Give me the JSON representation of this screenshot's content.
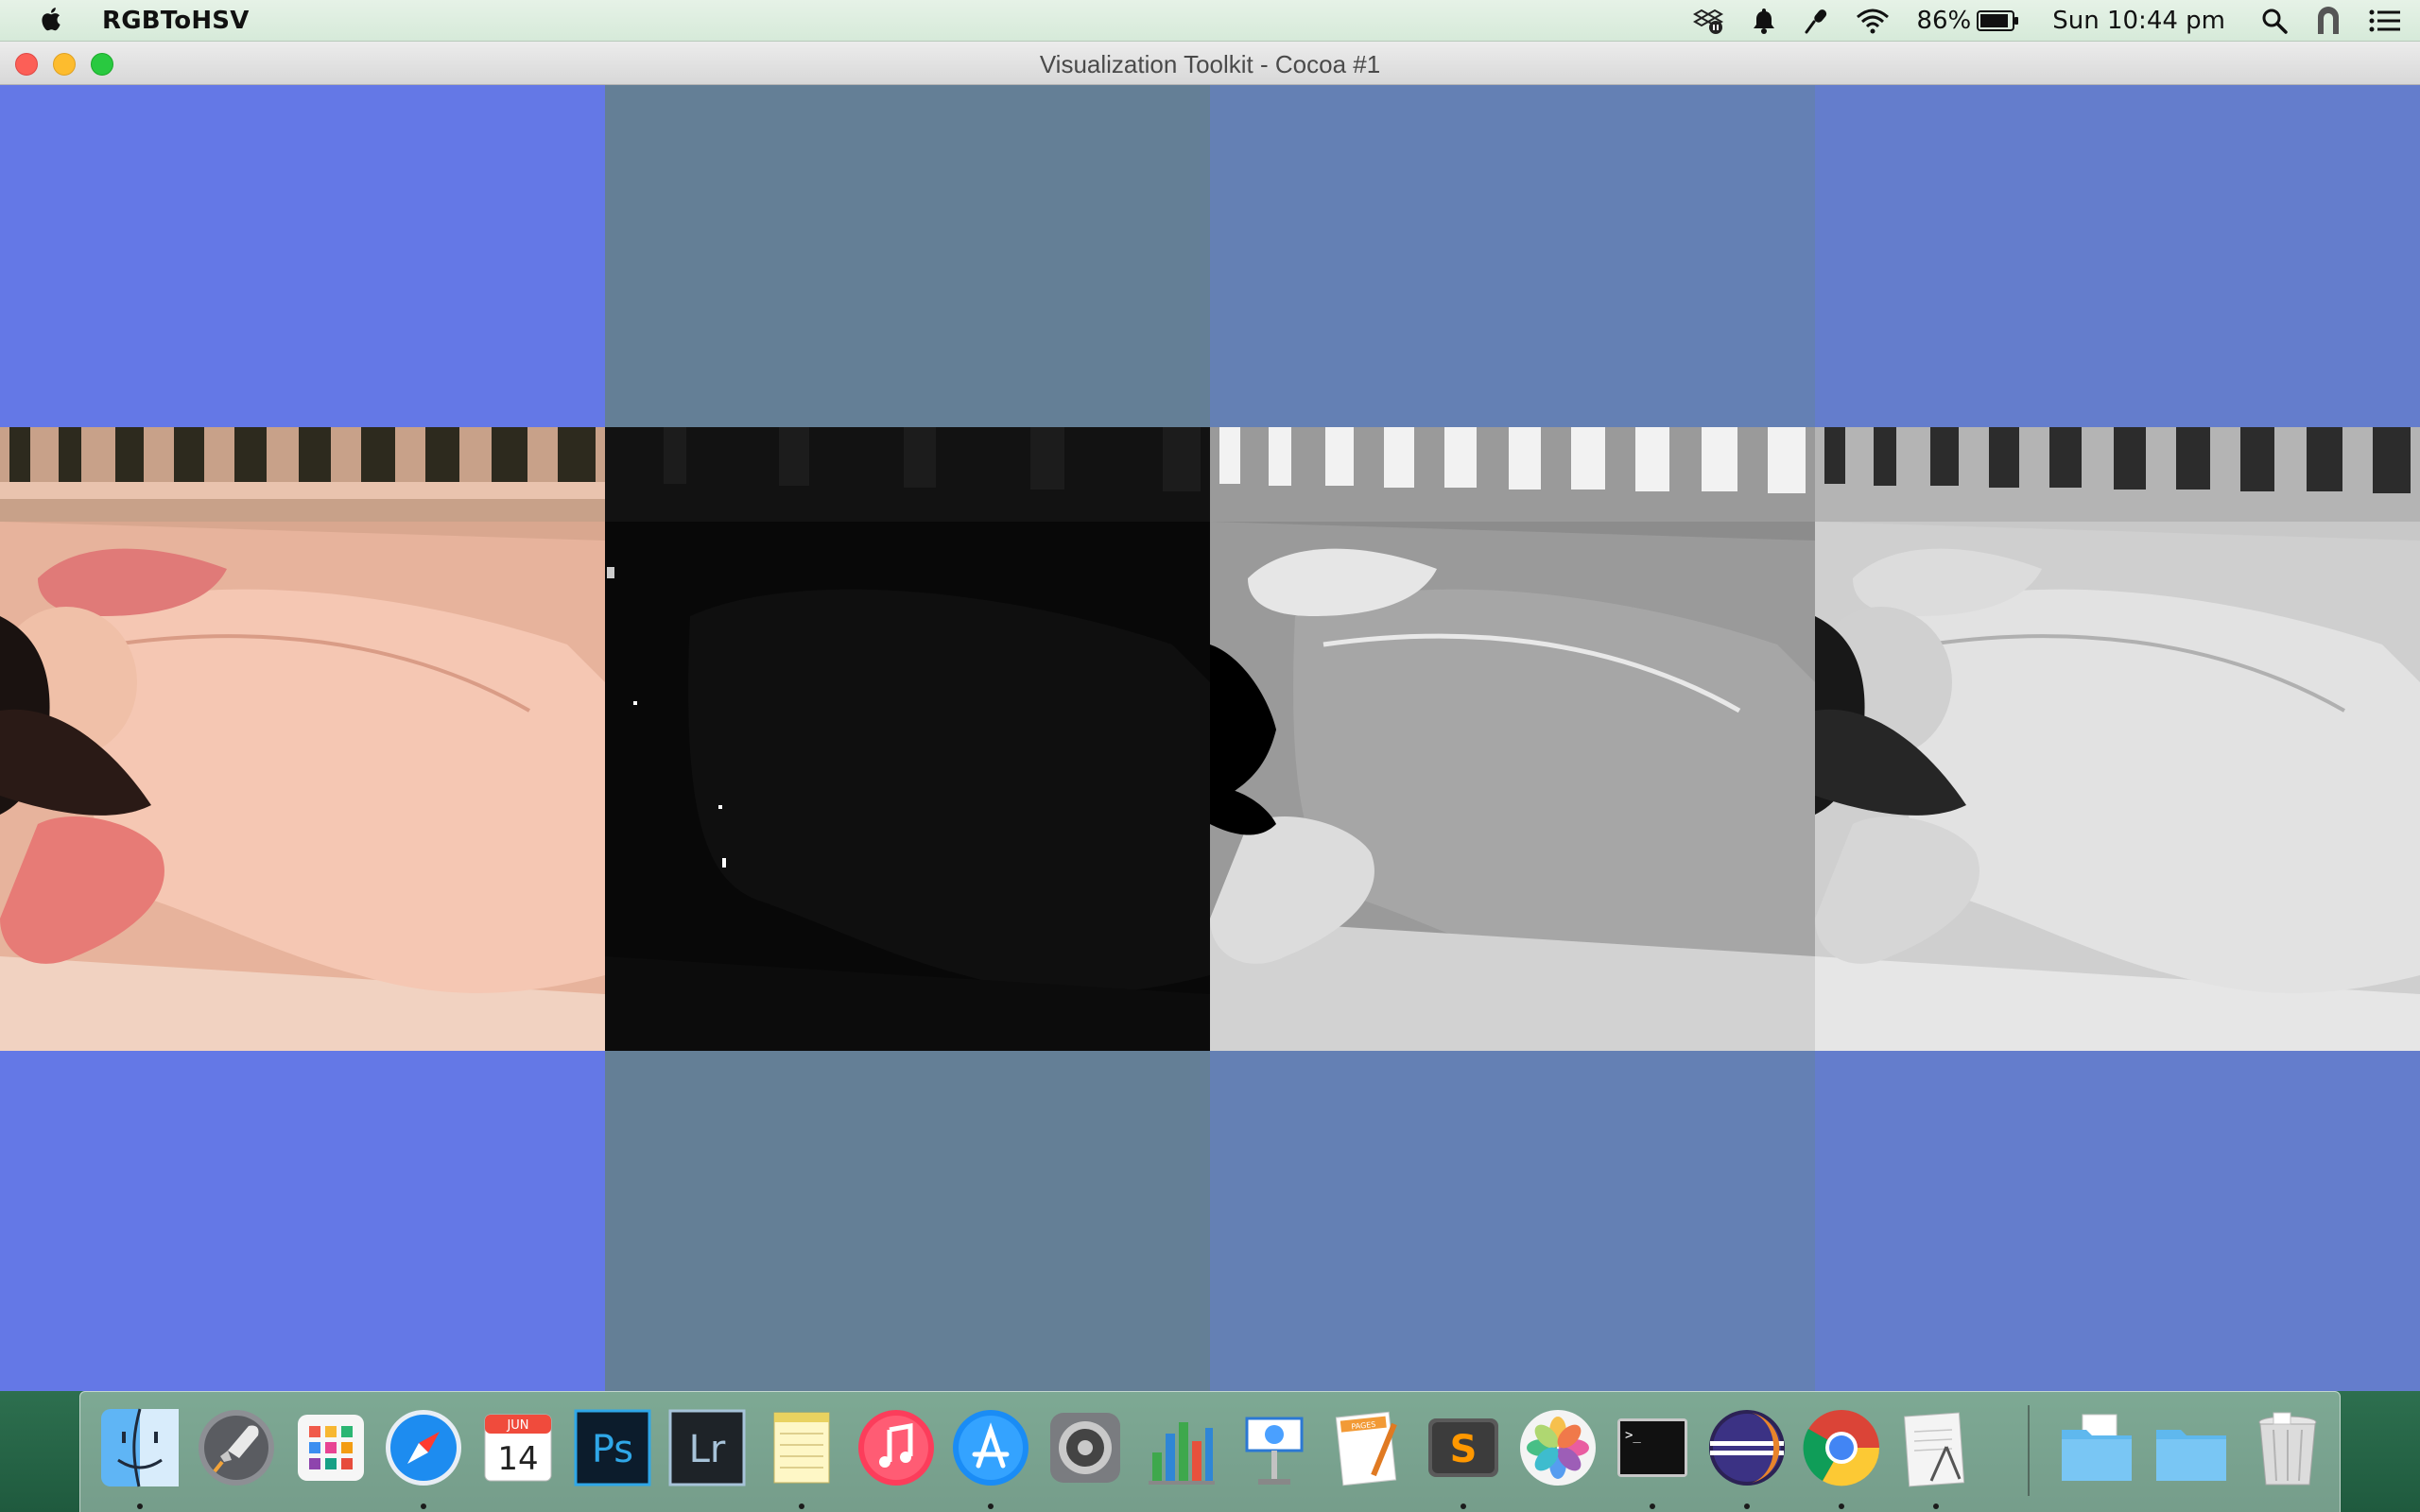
{
  "menubar": {
    "app_name": "RGBToHSV",
    "battery_percent": "86%",
    "clock": "Sun 10:44 pm"
  },
  "window": {
    "title": "Visualization Toolkit - Cocoa #1"
  },
  "viewports": [
    {
      "view": "rgb-original",
      "background": "#6478e6"
    },
    {
      "view": "hue-channel",
      "background": "#647f96"
    },
    {
      "view": "saturation-channel",
      "background": "#6480b4"
    },
    {
      "view": "value-channel",
      "background": "#647dcc"
    }
  ],
  "dock": {
    "calendar": {
      "month": "JUN",
      "day": "14"
    },
    "photoshop_label": "Ps",
    "lightroom_label": "Lr",
    "terminal_prompt": ">_",
    "sublime_label": "S",
    "pages_label": "PAGES",
    "items": [
      "Finder",
      "Launchpad",
      "Launchpad Apps",
      "Safari",
      "Calendar",
      "Photoshop",
      "Lightroom",
      "Notes",
      "iTunes",
      "App Store",
      "System Preferences",
      "Numbers",
      "Keynote",
      "Pages",
      "Sublime Text",
      "Photos",
      "Terminal",
      "Eclipse",
      "Chrome",
      "TextEdit",
      "Documents",
      "Downloads",
      "Trash"
    ]
  }
}
